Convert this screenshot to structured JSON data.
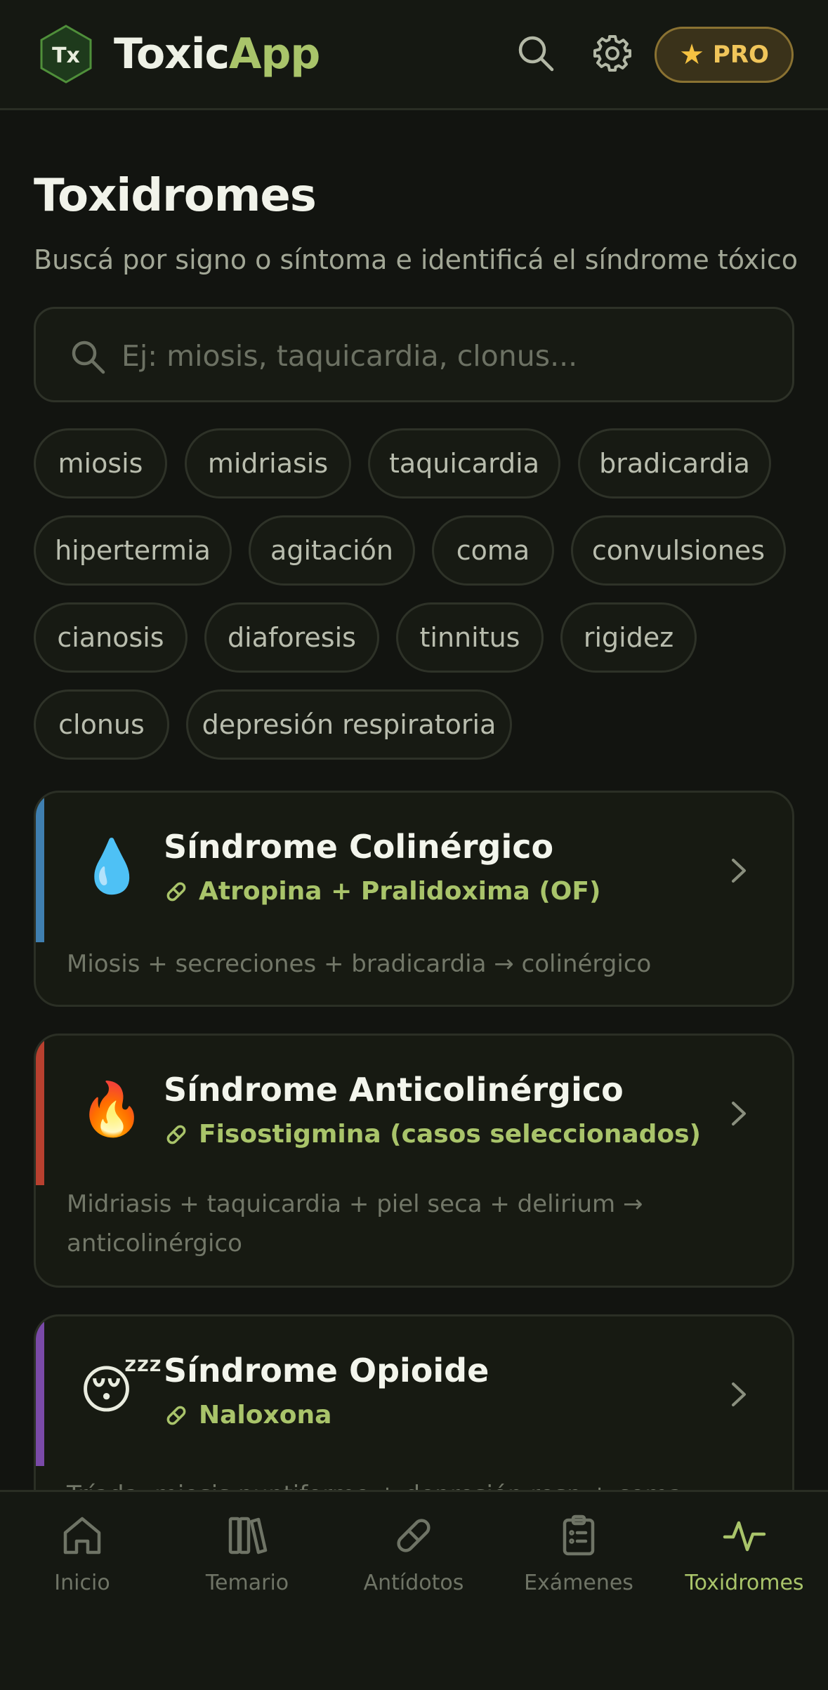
{
  "header": {
    "logo_text": "Tx",
    "brand_part1": "Toxic",
    "brand_part2": "App",
    "search_icon": "search-icon",
    "settings_icon": "gear-icon",
    "pro_label": "PRO",
    "pro_icon": "star-icon",
    "brand_color": "#a9c46a"
  },
  "page": {
    "title": "Toxidromes",
    "subtitle": "Buscá por signo o síntoma e identificá el síndrome tóxico"
  },
  "search": {
    "placeholder": "Ej: miosis, taquicardia, clonus...",
    "value": ""
  },
  "chips": [
    "miosis",
    "midriasis",
    "taquicardia",
    "bradicardia",
    "hipertermia",
    "agitación",
    "coma",
    "convulsiones",
    "cianosis",
    "diaforesis",
    "tinnitus",
    "rigidez",
    "clonus",
    "depresión respiratoria"
  ],
  "cards": [
    {
      "emoji": "💧",
      "title": "Síndrome Colinérgico",
      "antidote": "Atropina + Pralidoxima (OF)",
      "description": "Miosis + secreciones + bradicardia → colinérgico",
      "accent": "#3f7fb0"
    },
    {
      "emoji": "🔥",
      "title": "Síndrome Anticolinérgico",
      "antidote": "Fisostigmina (casos seleccionados)",
      "description": "Midriasis + taquicardia + piel seca + delirium → anticolinérgico",
      "accent": "#b8402f"
    },
    {
      "emoji": "😴",
      "title": "Síndrome Opioide",
      "antidote": "Naloxona",
      "description": "Tríada: miosis puntiforme + depresión resp + coma →",
      "accent": "#7a4aa8"
    }
  ],
  "nav": {
    "items": [
      {
        "label": "Inicio",
        "icon": "home-icon"
      },
      {
        "label": "Temario",
        "icon": "books-icon"
      },
      {
        "label": "Antídotos",
        "icon": "pill-icon"
      },
      {
        "label": "Exámenes",
        "icon": "clipboard-icon"
      },
      {
        "label": "Toxidromes",
        "icon": "pulse-icon",
        "active": true
      }
    ]
  }
}
